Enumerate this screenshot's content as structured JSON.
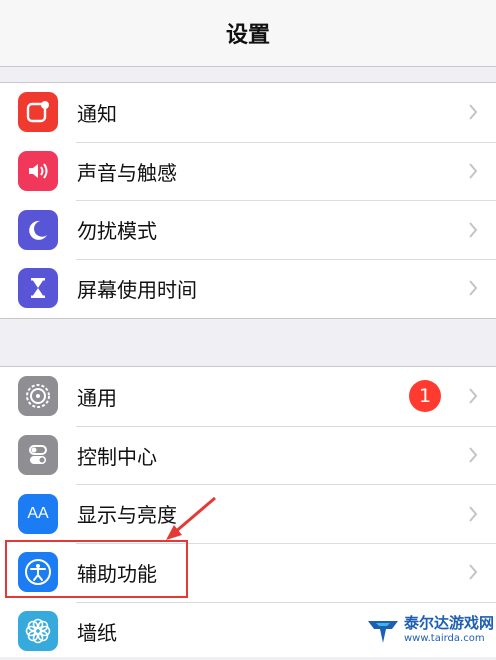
{
  "nav": {
    "title": "设置"
  },
  "group1": [
    {
      "label": "通知",
      "icon": "notifications-icon",
      "color": "#f03a30"
    },
    {
      "label": "声音与触感",
      "icon": "sounds-icon",
      "color": "#f1375a"
    },
    {
      "label": "勿扰模式",
      "icon": "do-not-disturb-moon-icon",
      "color": "#5856d6"
    },
    {
      "label": "屏幕使用时间",
      "icon": "screen-time-hourglass-icon",
      "color": "#5856d6"
    }
  ],
  "group2": [
    {
      "label": "通用",
      "icon": "general-gear-icon",
      "color": "#8e8e93",
      "badge": "1"
    },
    {
      "label": "控制中心",
      "icon": "control-center-icon",
      "color": "#8e8e93"
    },
    {
      "label": "显示与亮度",
      "icon": "display-brightness-icon",
      "color": "#1b7cf3",
      "icon_text": "AA"
    },
    {
      "label": "辅助功能",
      "icon": "accessibility-icon",
      "color": "#1b7cf3"
    },
    {
      "label": "墙纸",
      "icon": "wallpaper-flower-icon",
      "color": "#36aadc"
    }
  ],
  "colors": {
    "badge": "#ff3b30",
    "highlight": "#e53935",
    "chevron": "#c4c4c7"
  },
  "watermark": {
    "title": "泰尔达游戏网",
    "url": "www.tairda.com"
  }
}
